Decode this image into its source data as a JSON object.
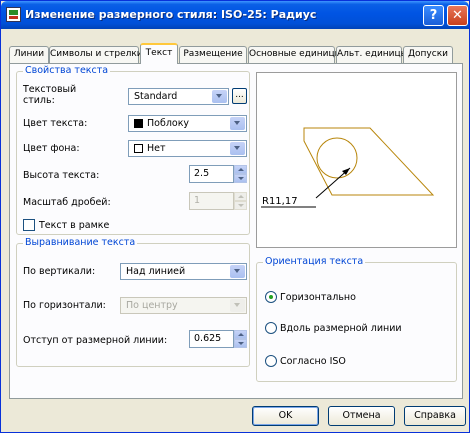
{
  "window": {
    "title": "Изменение размерного стиля: ISO-25: Радиус",
    "help_glyph": "?",
    "close_glyph": "✕"
  },
  "tabs": [
    {
      "label": "Линии"
    },
    {
      "label": "Символы и стрелки"
    },
    {
      "label": "Текст",
      "active": true
    },
    {
      "label": "Размещение"
    },
    {
      "label": "Основные единицы"
    },
    {
      "label": "Альт. единицы"
    },
    {
      "label": "Допуски"
    }
  ],
  "text_properties": {
    "title": "Свойства текста",
    "style_label": "Текстовый стиль:",
    "style_value": "Standard",
    "ellipsis": "...",
    "color_label": "Цвет текста:",
    "color_value": "Поблоку",
    "color_swatch": "#000000",
    "fill_label": "Цвет фона:",
    "fill_value": "Нет",
    "fill_swatch": "#ffffff",
    "height_label": "Высота текста:",
    "height_value": "2.5",
    "fraction_label": "Масштаб дробей:",
    "fraction_value": "1",
    "frame_label": "Текст в рамке",
    "frame_checked": false
  },
  "alignment": {
    "title": "Выравнивание текста",
    "vertical_label": "По вертикали:",
    "vertical_value": "Над линией",
    "horizontal_label": "По горизонтали:",
    "horizontal_value": "По центру",
    "offset_label": "Отступ от размерной линии:",
    "offset_value": "0.625"
  },
  "orientation": {
    "title": "Ориентация текста",
    "options": [
      {
        "label": "Горизонтально",
        "selected": true
      },
      {
        "label": "Вдоль размерной линии",
        "selected": false
      },
      {
        "label": "Согласно ISO",
        "selected": false
      }
    ]
  },
  "preview": {
    "dimension_text": "R11,17",
    "outline_color": "#b8860b"
  },
  "buttons": {
    "ok": "OK",
    "cancel": "Отмена",
    "help": "Справка"
  }
}
